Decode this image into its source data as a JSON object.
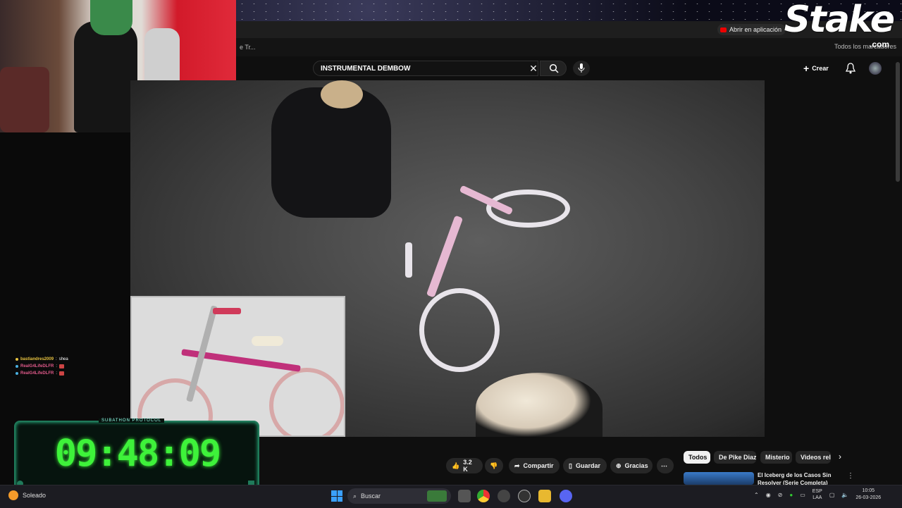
{
  "browser": {
    "open_in_app": "Abrir en aplicación",
    "bookmark_fragment": "e Tr...",
    "all_bookmarks": "Todos los marcadores"
  },
  "sponsor": {
    "logo": "Stake",
    "logo_suffix": ".com"
  },
  "youtube": {
    "search_value": "INSTRUMENTAL DEMBOW",
    "create_label": "Crear",
    "actions": {
      "likes": "3.2 K",
      "share": "Compartir",
      "save": "Guardar",
      "thanks": "Gracias",
      "more": "⋯"
    },
    "chips": [
      "Todos",
      "De Pike Diaz",
      "Misterio",
      "Videos rela"
    ],
    "recommended": [
      {
        "title": "El Iceberg de los Casos Sin Resolver (Serie Completa)"
      }
    ]
  },
  "chat": [
    {
      "user": "bastiandres2009",
      "sep": " : ",
      "message": "shea",
      "color": "#e8c340"
    },
    {
      "user": "RealG4LifeDLFR",
      "sep": " : ",
      "message": "",
      "color": "#e05a8a"
    },
    {
      "user": "RealG4LifeDLFR",
      "sep": " : ",
      "message": "",
      "color": "#e05a8a"
    }
  ],
  "subathon": {
    "label": "SUBATHON PROTOCOL",
    "time": "09:48:09"
  },
  "taskbar": {
    "weather": "Soleado",
    "search_placeholder": "Buscar",
    "lang_1": "ESP",
    "lang_2": "LAA",
    "time": "10:05",
    "date": "26-03-2026"
  },
  "colors": {
    "accent_green": "#3ef23a",
    "yt_red": "#ff0000",
    "timer_border": "#1f7a5a"
  }
}
